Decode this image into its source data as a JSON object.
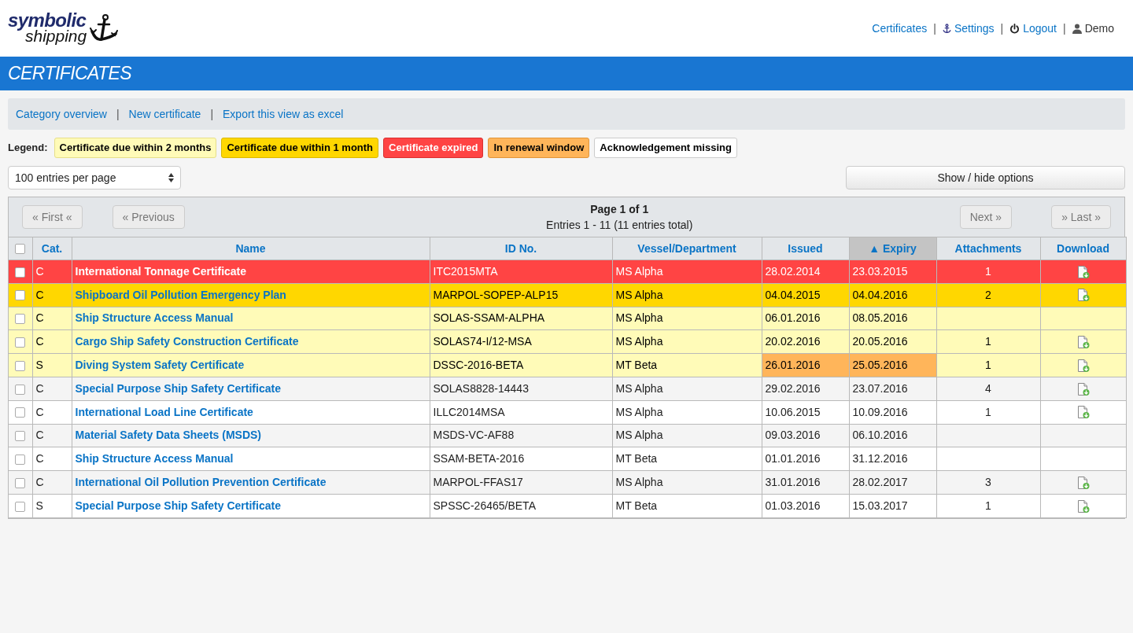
{
  "logo": {
    "line_1": "symbolic",
    "line_2": "shipping"
  },
  "top_nav": [
    {
      "label": "Certificates",
      "kind": "link"
    },
    {
      "label": "Settings",
      "kind": "settings"
    },
    {
      "label": "Logout",
      "kind": "logout"
    },
    {
      "label": "Demo",
      "kind": "user"
    }
  ],
  "top_nav_separator": "|",
  "page_title": "CERTIFICATES",
  "actions_separator": "|",
  "actions": [
    "Category overview",
    "New certificate",
    "Export this view as excel"
  ],
  "legend": {
    "label": "Legend:",
    "items": [
      {
        "label": "Certificate due within 2 months",
        "kind": "due2"
      },
      {
        "label": "Certificate due within 1 month",
        "kind": "due1"
      },
      {
        "label": "Certificate expired",
        "kind": "expired"
      },
      {
        "label": "In renewal window",
        "kind": "renewal"
      },
      {
        "label": "Acknowledgement missing",
        "kind": "ack"
      }
    ]
  },
  "page_size": {
    "value": "100 entries per page"
  },
  "options_button": "Show / hide options",
  "pager": {
    "first": "« First «",
    "previous": "« Previous",
    "title": "Page 1 of 1",
    "summary": "Entries 1 - 11 (11 entries total)",
    "next": "Next »",
    "last": "» Last »"
  },
  "table": {
    "select_all_checked": false,
    "columns": [
      {
        "label": "Cat.",
        "sorted": false
      },
      {
        "label": "Name",
        "sorted": false
      },
      {
        "label": "ID No.",
        "sorted": false
      },
      {
        "label": "Vessel/Department",
        "sorted": false
      },
      {
        "label": "Issued",
        "sorted": false
      },
      {
        "label": "Expiry",
        "sorted": true,
        "sort_mark": "▲"
      },
      {
        "label": "Attachments",
        "sorted": false
      },
      {
        "label": "Download",
        "sorted": false
      }
    ],
    "rows": [
      {
        "checked": false,
        "kind": "expired",
        "renewal": false,
        "cat": "C",
        "name": "International Tonnage Certificate",
        "id": "ITC2015MTA",
        "vessel": "MS Alpha",
        "issued": "28.02.2014",
        "expiry": "23.03.2015",
        "attachments": "1",
        "download": true
      },
      {
        "checked": false,
        "kind": "due1",
        "renewal": false,
        "cat": "C",
        "name": "Shipboard Oil Pollution Emergency Plan",
        "id": "MARPOL-SOPEP-ALP15",
        "vessel": "MS Alpha",
        "issued": "04.04.2015",
        "expiry": "04.04.2016",
        "attachments": "2",
        "download": true
      },
      {
        "checked": false,
        "kind": "due2",
        "renewal": false,
        "cat": "C",
        "name": "Ship Structure Access Manual",
        "id": "SOLAS-SSAM-ALPHA",
        "vessel": "MS Alpha",
        "issued": "06.01.2016",
        "expiry": "08.05.2016",
        "download": false
      },
      {
        "checked": false,
        "kind": "due2",
        "renewal": false,
        "cat": "C",
        "name": "Cargo Ship Safety Construction Certificate",
        "id": "SOLAS74-I/12-MSA",
        "vessel": "MS Alpha",
        "issued": "20.02.2016",
        "expiry": "20.05.2016",
        "attachments": "1",
        "download": true
      },
      {
        "checked": false,
        "kind": "due2",
        "renewal": true,
        "cat": "S",
        "name": "Diving System Safety Certificate",
        "id": "DSSC-2016-BETA",
        "vessel": "MT Beta",
        "issued": "26.01.2016",
        "expiry": "25.05.2016",
        "attachments": "1",
        "download": true
      },
      {
        "checked": false,
        "kind": "normal",
        "renewal": false,
        "cat": "C",
        "name": "Special Purpose Ship Safety Certificate",
        "id": "SOLAS8828-14443",
        "vessel": "MS Alpha",
        "issued": "29.02.2016",
        "expiry": "23.07.2016",
        "attachments": "4",
        "download": true
      },
      {
        "checked": false,
        "kind": "normal",
        "renewal": false,
        "cat": "C",
        "name": "International Load Line Certificate",
        "id": "ILLC2014MSA",
        "vessel": "MS Alpha",
        "issued": "10.06.2015",
        "expiry": "10.09.2016",
        "attachments": "1",
        "download": true
      },
      {
        "checked": false,
        "kind": "normal",
        "renewal": false,
        "cat": "C",
        "name": "Material Safety Data Sheets (MSDS)",
        "id": "MSDS-VC-AF88",
        "vessel": "MS Alpha",
        "issued": "09.03.2016",
        "expiry": "06.10.2016",
        "download": false
      },
      {
        "checked": false,
        "kind": "normal",
        "renewal": false,
        "cat": "C",
        "name": "Ship Structure Access Manual",
        "id": "SSAM-BETA-2016",
        "vessel": "MT Beta",
        "issued": "01.01.2016",
        "expiry": "31.12.2016",
        "download": false
      },
      {
        "checked": false,
        "kind": "normal",
        "renewal": false,
        "cat": "C",
        "name": "International Oil Pollution Prevention Certificate",
        "id": "MARPOL-FFAS17",
        "vessel": "MS Alpha",
        "issued": "31.01.2016",
        "expiry": "28.02.2017",
        "attachments": "3",
        "download": true
      },
      {
        "checked": false,
        "kind": "normal",
        "renewal": false,
        "cat": "S",
        "name": "Special Purpose Ship Safety Certificate",
        "id": "SPSSC-26465/BETA",
        "vessel": "MT Beta",
        "issued": "01.03.2016",
        "expiry": "15.03.2017",
        "attachments": "1",
        "download": true
      }
    ]
  }
}
